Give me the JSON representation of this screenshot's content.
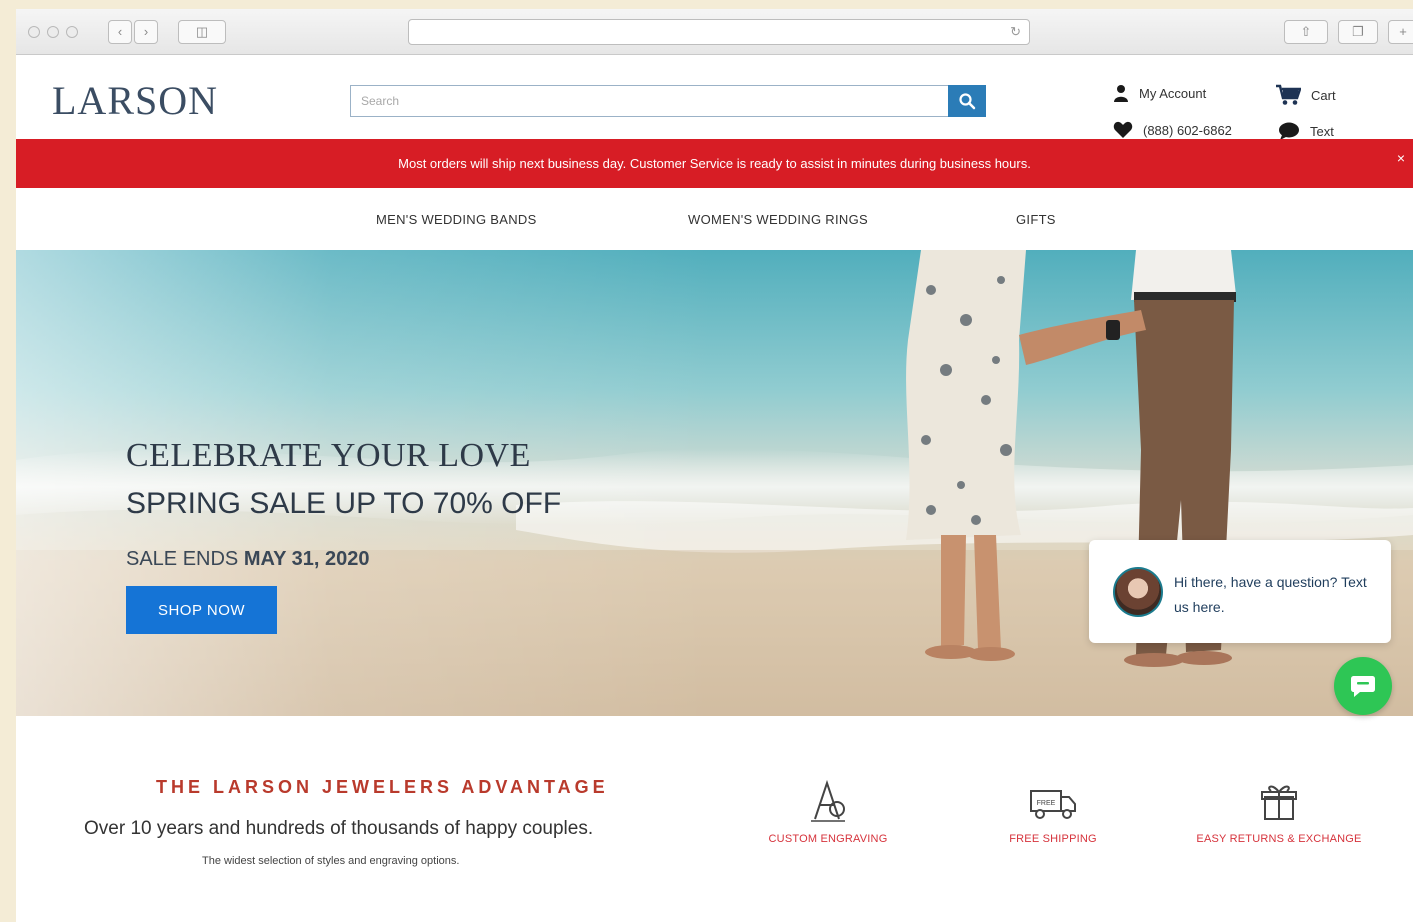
{
  "header": {
    "logo": "LARSON",
    "search_placeholder": "Search",
    "my_account": "My Account",
    "cart": "Cart",
    "phone": "(888) 602-6862",
    "text": "Text"
  },
  "promo": {
    "message": "Most orders will ship next business day. Customer Service is ready to assist in minutes during business hours.",
    "close": "×"
  },
  "nav": {
    "items": [
      "MEN'S WEDDING BANDS",
      "WOMEN'S WEDDING RINGS",
      "GIFTS"
    ]
  },
  "hero": {
    "headline": "CELEBRATE YOUR LOVE",
    "subheadline": "SPRING SALE UP TO 70% OFF",
    "ends_label": "SALE ENDS",
    "ends_date": "MAY 31, 2020",
    "cta": "SHOP NOW"
  },
  "chat": {
    "message": "Hi there, have a question? Text us here."
  },
  "advantages": {
    "title": "THE LARSON JEWELERS ADVANTAGE",
    "subtitle": "Over 10 years and hundreds of thousands of happy couples.",
    "note": "The widest selection of styles and engraving options.",
    "features": [
      {
        "label": "CUSTOM ENGRAVING",
        "icon": "engraving-icon"
      },
      {
        "label": "FREE SHIPPING",
        "icon": "truck-icon"
      },
      {
        "label": "EASY RETURNS & EXCHANGE",
        "icon": "gift-box-icon"
      }
    ]
  },
  "colors": {
    "promo_bg": "#d71d25",
    "accent": "#1574d6",
    "chat": "#2ec655",
    "advantage_title": "#b93a2c"
  }
}
